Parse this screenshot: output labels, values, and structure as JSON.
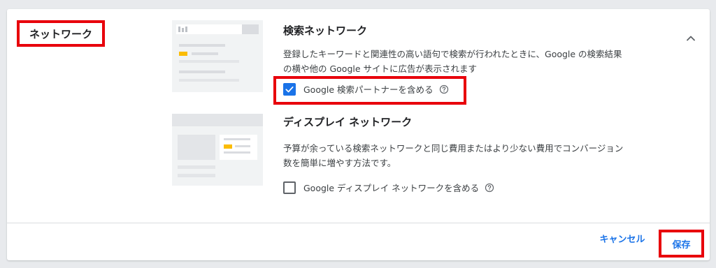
{
  "section": {
    "title": "ネットワーク"
  },
  "search_network": {
    "heading": "検索ネットワーク",
    "description_lines": [
      "登録したキーワードと関連性の高い語句で検索が行われたときに、Google の検索結果",
      "の横や他の Google サイトに広告が表示されます"
    ],
    "checkbox_label": "Google 検索パートナーを含める",
    "checked": true
  },
  "display_network": {
    "heading": "ディスプレイ ネットワーク",
    "description_lines": [
      "予算が余っている検索ネットワークと同じ費用またはより少ない費用でコンバージョン",
      "数を簡単に増やす方法です。"
    ],
    "checkbox_label": "Google ディスプレイ ネットワークを含める",
    "checked": false
  },
  "footer": {
    "cancel_label": "キャンセル",
    "save_label": "保存"
  },
  "icons": {
    "collapse": "chevron-up-icon",
    "help": "help-circle-icon",
    "check": "check-icon"
  },
  "colors": {
    "accent": "#1a73e8",
    "highlight": "#e8000b",
    "ad_marker": "#fbbc04",
    "illustration_bg": "#f1f3f4"
  }
}
